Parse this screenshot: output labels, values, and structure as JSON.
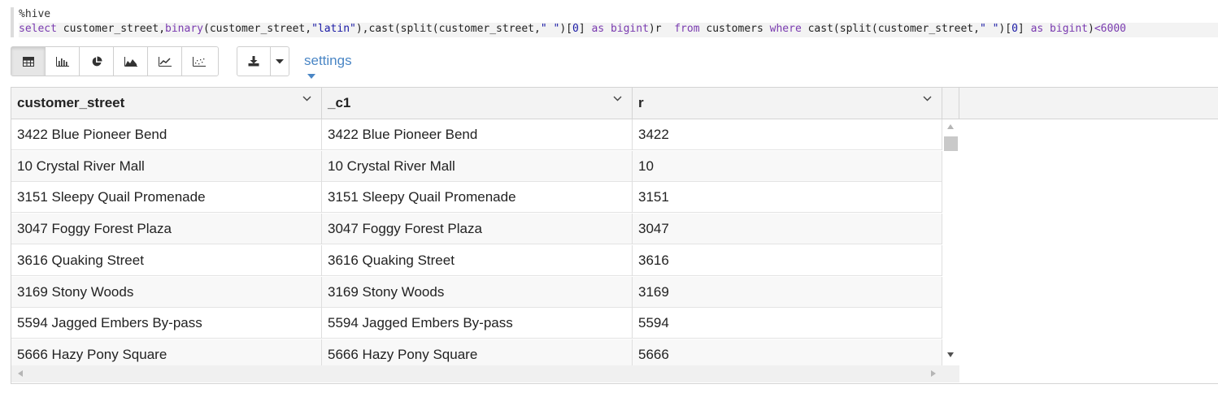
{
  "editor": {
    "line1": "%hive",
    "line2": [
      {
        "t": "select",
        "c": "kw"
      },
      {
        "t": " customer_street,",
        "c": "plain"
      },
      {
        "t": "binary",
        "c": "fn"
      },
      {
        "t": "(customer_street,",
        "c": "plain"
      },
      {
        "t": "\"latin\"",
        "c": "str"
      },
      {
        "t": "),cast(split(customer_street,",
        "c": "plain"
      },
      {
        "t": "\" \"",
        "c": "str"
      },
      {
        "t": ")[",
        "c": "plain"
      },
      {
        "t": "0",
        "c": "num"
      },
      {
        "t": "] ",
        "c": "plain"
      },
      {
        "t": "as",
        "c": "kw"
      },
      {
        "t": " ",
        "c": "plain"
      },
      {
        "t": "bigint",
        "c": "kw"
      },
      {
        "t": ")r  ",
        "c": "plain"
      },
      {
        "t": "from",
        "c": "kw"
      },
      {
        "t": " customers ",
        "c": "plain"
      },
      {
        "t": "where",
        "c": "kw"
      },
      {
        "t": " cast(split(customer_street,",
        "c": "plain"
      },
      {
        "t": "\" \"",
        "c": "str"
      },
      {
        "t": ")[",
        "c": "plain"
      },
      {
        "t": "0",
        "c": "num"
      },
      {
        "t": "] ",
        "c": "plain"
      },
      {
        "t": "as",
        "c": "kw"
      },
      {
        "t": " ",
        "c": "plain"
      },
      {
        "t": "bigint",
        "c": "kw"
      },
      {
        "t": ")",
        "c": "plain"
      },
      {
        "t": "<6000",
        "c": "kw"
      }
    ]
  },
  "toolbar": {
    "viz_buttons": [
      "table-icon",
      "bar-chart-icon",
      "pie-chart-icon",
      "area-chart-icon",
      "line-chart-icon",
      "scatter-chart-icon"
    ],
    "active": "table-icon",
    "download_icon": "download-icon",
    "dropdown_icon": "caret-down-icon",
    "settings_label": "settings"
  },
  "grid": {
    "columns": [
      "customer_street",
      "_c1",
      "r"
    ],
    "rows": [
      [
        "3422 Blue Pioneer Bend",
        "3422 Blue Pioneer Bend",
        "3422"
      ],
      [
        "10 Crystal River Mall",
        "10 Crystal River Mall",
        "10"
      ],
      [
        "3151 Sleepy Quail Promenade",
        "3151 Sleepy Quail Promenade",
        "3151"
      ],
      [
        "3047 Foggy Forest Plaza",
        "3047 Foggy Forest Plaza",
        "3047"
      ],
      [
        "3616 Quaking Street",
        "3616 Quaking Street",
        "3616"
      ],
      [
        "3169 Stony Woods",
        "3169 Stony Woods",
        "3169"
      ],
      [
        "5594 Jagged Embers By-pass",
        "5594 Jagged Embers By-pass",
        "5594"
      ],
      [
        "5666 Hazy Pony Square",
        "5666 Hazy Pony Square",
        "5666"
      ]
    ]
  },
  "colors": {
    "accent": "#4a86c5",
    "keyword": "#7a3bb0",
    "string": "#1a1aa6"
  }
}
